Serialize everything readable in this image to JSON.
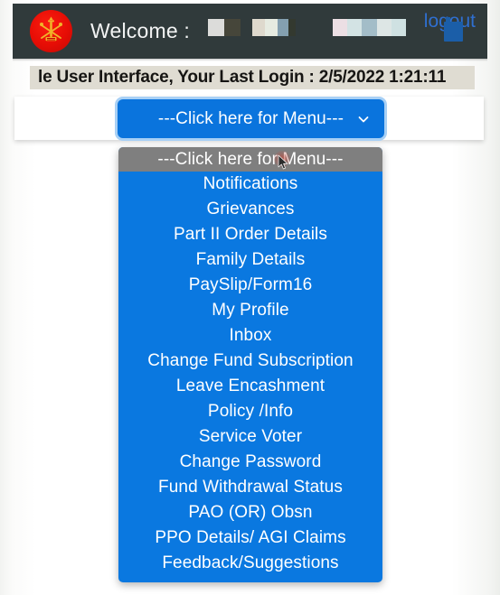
{
  "header": {
    "logo_name": "army-crest-logo",
    "welcome_label": "Welcome :",
    "redacted_name_blocks": 3,
    "logout_label": "logout",
    "bar_color": "#303a3b",
    "logout_color": "#2f6fd0"
  },
  "banner": {
    "text": "le User Interface, Your Last Login : 2/5/2022 1:21:11",
    "background": "#dfdcd2"
  },
  "select": {
    "value": "---Click here for Menu---",
    "expanded": true,
    "accent": "#0a74dd",
    "focus_ring": "#a8d0f5",
    "highlight": "#7f7f7f",
    "options": [
      "---Click here for Menu---",
      "Notifications",
      "Grievances",
      "Part II Order Details",
      "Family Details",
      "PaySlip/Form16",
      "My Profile",
      "Inbox",
      "Change Fund Subscription",
      "Leave Encashment",
      "Policy /Info",
      "Service Voter",
      "Change Password",
      "Fund Withdrawal Status",
      "PAO (OR) Obsn",
      "PPO Details/ AGI Claims",
      "Feedback/Suggestions"
    ],
    "selected_index": 0
  }
}
